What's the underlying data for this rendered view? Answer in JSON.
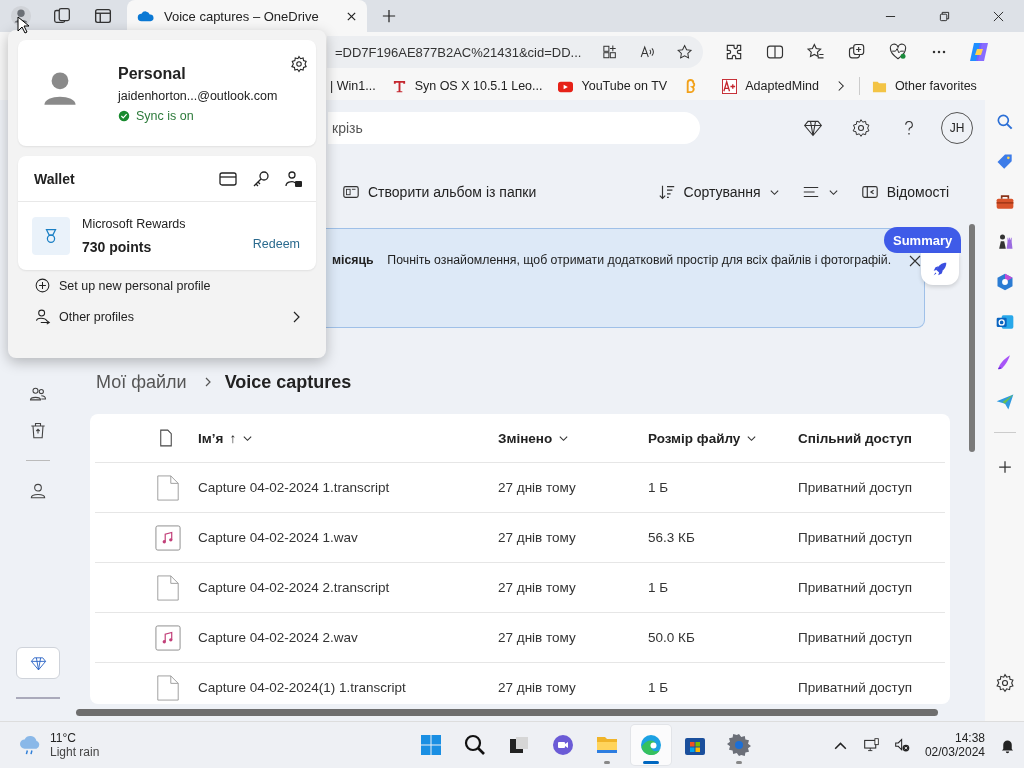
{
  "tabs": [
    {
      "title": "Voice captures – OneDrive",
      "selected": true
    }
  ],
  "address": {
    "value": "=DD7F196AE877B2AC%21431&cid=DD..."
  },
  "favorites": [
    {
      "label": "| Win1...",
      "kind": "plain"
    },
    {
      "label": "Syn OS X 10.5.1 Leo...",
      "kind": "font"
    },
    {
      "label": "YouTube on TV",
      "kind": "video"
    },
    {
      "kind": "coin"
    },
    {
      "label": "AdaptedMind",
      "kind": "adapted"
    }
  ],
  "other_favorites": "Other favorites",
  "profile_menu": {
    "name": "Personal",
    "email": "jaidenhorton...@outlook.com",
    "sync": "Sync is on",
    "wallet": {
      "title": "Wallet",
      "rewards_title": "Microsoft Rewards",
      "points": "730 points",
      "redeem": "Redeem"
    },
    "items": [
      {
        "label": "Set up new personal profile",
        "kind": "add"
      },
      {
        "label": "Other profiles",
        "kind": "switch"
      }
    ]
  },
  "onedrive": {
    "search": {
      "placeholder": "крізь"
    },
    "avatar": "JH",
    "commands": [
      {
        "label": "Створити альбом із папки",
        "kind": "album"
      },
      {
        "label": "Сортування",
        "kind": "sort"
      },
      {
        "kind": "view"
      },
      {
        "label": "Відомості",
        "kind": "details"
      }
    ],
    "banner": {
      "lead": "місяць",
      "text": "Почніть ознайомлення, щоб отримати додатковий простір для всіх файлів і фотографій."
    },
    "summary": "Summary",
    "breadcrumb": [
      "Мої файли",
      "Voice captures"
    ],
    "table": {
      "columns": [
        {
          "label": "Ім’я",
          "arrow": "↑",
          "dropdown": true
        },
        {
          "label": "Змінено",
          "dropdown": true
        },
        {
          "label": "Розмір файлу",
          "dropdown": true
        },
        {
          "label": "Спільний доступ",
          "dropdown": false
        }
      ],
      "rows": [
        {
          "kind": "transcript",
          "name": "Capture 04-02-2024 1.transcript",
          "modified": "27 днів тому",
          "size": "1 Б",
          "sharing": "Приватний доступ"
        },
        {
          "kind": "audio",
          "name": "Capture 04-02-2024 1.wav",
          "modified": "27 днів тому",
          "size": "56.3 КБ",
          "sharing": "Приватний доступ"
        },
        {
          "kind": "transcript",
          "name": "Capture 04-02-2024 2.transcript",
          "modified": "27 днів тому",
          "size": "1 Б",
          "sharing": "Приватний доступ"
        },
        {
          "kind": "audio",
          "name": "Capture 04-02-2024 2.wav",
          "modified": "27 днів тому",
          "size": "50.0 КБ",
          "sharing": "Приватний доступ"
        },
        {
          "kind": "transcript",
          "name": "Capture 04-02-2024(1) 1.transcript",
          "modified": "27 днів тому",
          "size": "1 Б",
          "sharing": "Приватний доступ"
        }
      ]
    }
  },
  "taskbar": {
    "weather": {
      "temp": "11°C",
      "desc": "Light rain"
    },
    "apps": [
      {
        "kind": "start",
        "running": false,
        "selected": false
      },
      {
        "kind": "search",
        "running": false,
        "selected": false
      },
      {
        "kind": "taskview",
        "running": false,
        "selected": false
      },
      {
        "kind": "chat",
        "running": false,
        "selected": false
      },
      {
        "kind": "files",
        "running": true,
        "selected": false
      },
      {
        "kind": "edge",
        "running": true,
        "selected": true
      },
      {
        "kind": "store",
        "running": false,
        "selected": false
      },
      {
        "kind": "settings",
        "running": true,
        "selected": false
      }
    ],
    "time": "14:38",
    "date": "02/03/2024"
  }
}
